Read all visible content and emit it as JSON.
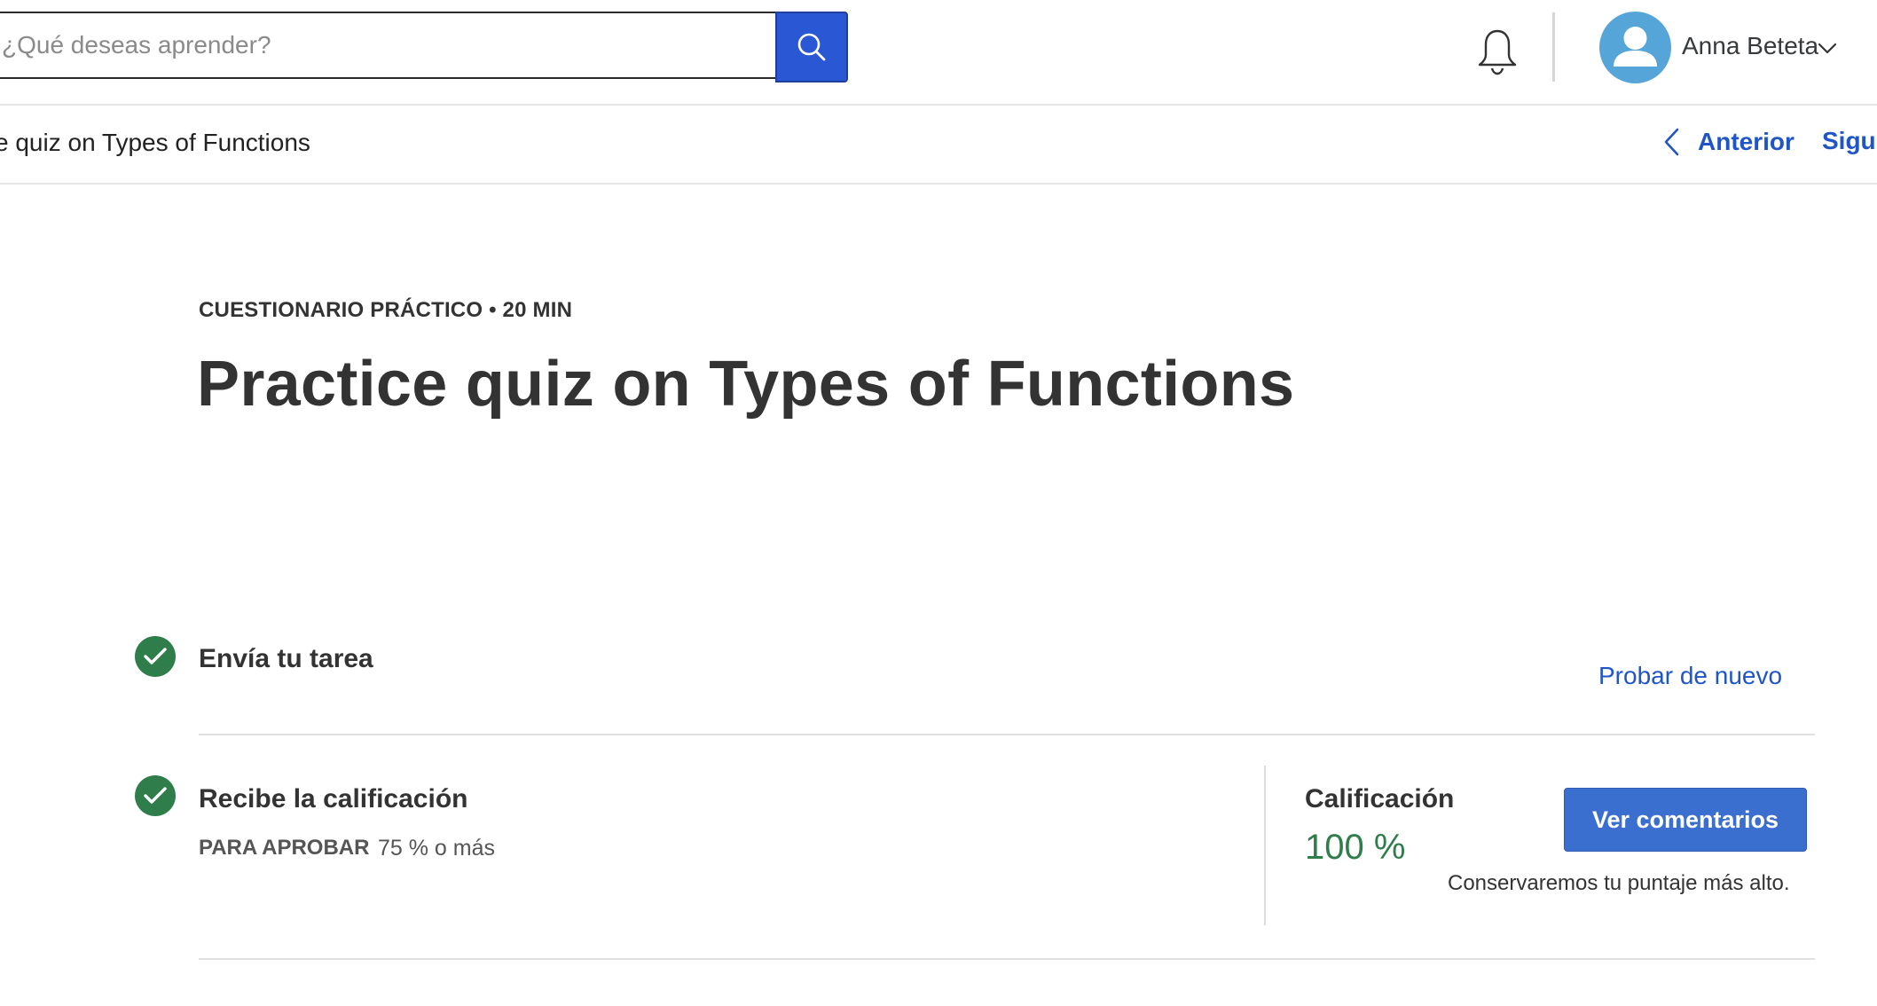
{
  "header": {
    "search_placeholder": "¿Qué deseas aprender?",
    "search_button_icon": "search-icon",
    "notifications_icon": "bell-icon",
    "user_name": "Anna Beteta",
    "user_menu_icon": "chevron-down-icon",
    "avatar_icon": "user-avatar-icon"
  },
  "breadcrumb": {
    "text": "e quiz on Types of Functions",
    "prev_label": "Anterior",
    "prev_icon": "chevron-left-icon",
    "next_label": "Sigui"
  },
  "main": {
    "eyebrow": "CUESTIONARIO PRÁCTICO • 20 MIN",
    "title": "Practice quiz on Types of Functions",
    "steps": [
      {
        "label": "Envía tu tarea",
        "status_icon": "check-circle-icon",
        "action_label": "Probar de nuevo"
      },
      {
        "label": "Recibe la calificación",
        "status_icon": "check-circle-icon",
        "pass_key": "PARA APROBAR",
        "pass_value": "75 % o más"
      }
    ],
    "grade": {
      "label": "Calificación",
      "value": "100 %",
      "button_label": "Ver comentarios",
      "note": "Conservaremos tu puntaje más alto."
    }
  },
  "colors": {
    "accent_blue": "#1f55c7",
    "search_button": "#2a57d4",
    "success_green": "#2f7d4b",
    "avatar_bg": "#56a5d8"
  }
}
